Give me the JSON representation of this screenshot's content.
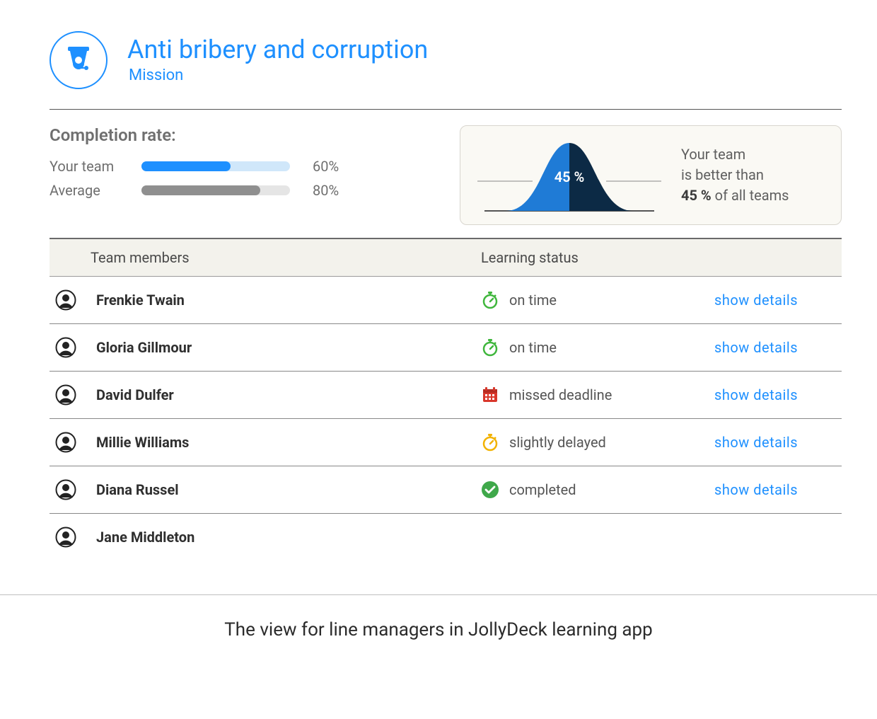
{
  "header": {
    "title": "Anti bribery and corruption",
    "subtitle": "Mission"
  },
  "completion": {
    "title": "Completion rate:",
    "rows": [
      {
        "label": "Your team",
        "percent": 60,
        "color": "blue"
      },
      {
        "label": "Average",
        "percent": 80,
        "color": "grey"
      }
    ]
  },
  "distribution": {
    "percent_label": "45 %",
    "text_line1": "Your team",
    "text_line2": "is better than",
    "text_strong": "45 %",
    "text_tail": " of all teams"
  },
  "table": {
    "head_member": "Team members",
    "head_status": "Learning status",
    "action_label": "show  details",
    "rows": [
      {
        "name": "Frenkie Twain",
        "status": "on time",
        "status_kind": "ontime",
        "show_action": true
      },
      {
        "name": "Gloria Gillmour",
        "status": "on time",
        "status_kind": "ontime",
        "show_action": true
      },
      {
        "name": "David Dulfer",
        "status": "missed deadline",
        "status_kind": "missed",
        "show_action": true
      },
      {
        "name": "Millie Williams",
        "status": "slightly delayed",
        "status_kind": "delayed",
        "show_action": true
      },
      {
        "name": "Diana Russel",
        "status": "completed",
        "status_kind": "completed",
        "show_action": true
      },
      {
        "name": "Jane Middleton",
        "status": "",
        "status_kind": "",
        "show_action": false
      }
    ]
  },
  "caption": "The view for line managers in JollyDeck learning app",
  "colors": {
    "accent": "#1e90ff",
    "ontime": "#3fb63c",
    "delayed": "#f2b200",
    "missed": "#d9372b",
    "completed": "#3fa84a"
  }
}
